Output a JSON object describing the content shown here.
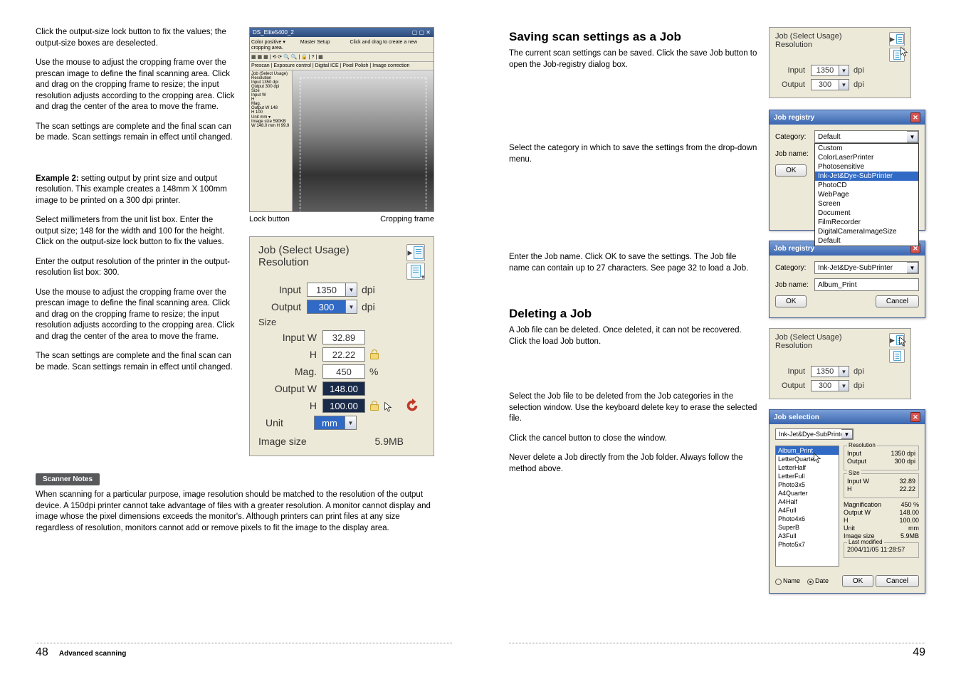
{
  "left": {
    "paragraphs": [
      "Click the output-size lock button to fix the values; the output-size boxes are deselected.",
      "Use the mouse to adjust the cropping frame over the prescan image to define the final scanning area. Click and drag on the cropping frame to resize; the input resolution adjusts according to the cropping area. Click and drag the center of the area to move the frame.",
      "The scan settings are complete and the final scan can be made. Scan settings remain in effect until changed."
    ],
    "example_strong": "Example 2:",
    "example_rest": " setting output by print size and output resolution. This example creates a 148mm X 100mm image to be printed on a 300 dpi printer.",
    "paragraphs2": [
      "Select millimeters from the unit list box. Enter the output size; 148 for the width and 100 for the height. Click on the output-size lock button to fix the values.",
      "Enter the output resolution of the printer in the output-resolution list box: 300.",
      "Use the mouse to adjust the cropping frame over the prescan image to define the final scanning area. Click and drag on the cropping frame to resize; the input resolution adjusts according to the cropping area. Click and drag the center of the area to move the frame.",
      "The scan settings are complete and the final scan can be made. Scan settings remain in effect until changed."
    ],
    "captions": {
      "lock": "Lock button",
      "crop": "Cropping frame"
    },
    "screenshot_title": "DS_Elite5400_2",
    "notes_label": "Scanner Notes",
    "notes_text": "When scanning for a particular purpose, image resolution should be matched to the resolution of the output device. A 150dpi printer cannot take advantage of files with a greater resolution. A monitor cannot display and image whose the pixel dimensions exceeds the monitor's. Although printers can print files at any size regardless of resolution, monitors cannot add or remove pixels to fit the image to the display area.",
    "panel": {
      "title": "Job (Select Usage)",
      "res": "Resolution",
      "input_lbl": "Input",
      "input_val": "1350",
      "dpi": "dpi",
      "output_lbl": "Output",
      "output_val": "300",
      "size_lbl": "Size",
      "inW_lbl": "Input   W",
      "inW_val": "32.89",
      "inH_lbl": "H",
      "inH_val": "22.22",
      "mag_lbl": "Mag.",
      "mag_val": "450",
      "pct": "%",
      "outW_lbl": "Output   W",
      "outW_val": "148.00",
      "outH_lbl": "H",
      "outH_val": "100.00",
      "unit_lbl": "Unit",
      "unit_val": "mm",
      "img_sz_lbl": "Image size",
      "img_sz_val": "5.9MB"
    },
    "page_num": "48",
    "section": "Advanced scanning"
  },
  "right": {
    "saving_title": "Saving scan settings as a Job",
    "saving_text": "The current scan settings can be saved. Click the save Job button to open the Job-registry dialog box.",
    "select_cat": "Select the category in which to save the settings from the drop-down menu.",
    "enter_job": "Enter the Job name. Click OK to save the settings. The Job file name can contain up to 27 characters. See page 32 to load a Job.",
    "delete_title": "Deleting a Job",
    "delete_text": "A Job file can be deleted. Once deleted, it can not be recovered. Click the load Job button.",
    "select_file": "Select the Job file to be deleted from the Job categories in the selection window. Use the keyboard delete key to erase the selected file.",
    "cancel_close": "Click the cancel button to close the window.",
    "never": "Never delete a Job directly from the Job folder. Always follow the method above.",
    "panel_small": {
      "title": "Job (Select Usage)",
      "res": "Resolution",
      "input_lbl": "Input",
      "input_val": "1350",
      "dpi": "dpi",
      "output_lbl": "Output",
      "output_val": "300"
    },
    "reg_dialog": {
      "title": "Job registry",
      "cat_lbl": "Category:",
      "cat_val": "Default",
      "name_lbl": "Job name:",
      "ok": "OK",
      "options": [
        "Custom",
        "ColorLaserPrinter",
        "Photosensitive",
        "Ink-Jet&Dye-SubPrinter",
        "PhotoCD",
        "WebPage",
        "Screen",
        "Document",
        "FilmRecorder",
        "DigitalCameraImageSize",
        "Default"
      ],
      "sel_idx": 3
    },
    "reg_dialog2": {
      "title": "Job registry",
      "cat_lbl": "Category:",
      "cat_val": "Ink-Jet&Dye-SubPrinter",
      "name_lbl": "Job name:",
      "name_val": "Album_Print",
      "ok": "OK",
      "cancel": "Cancel"
    },
    "jsel": {
      "title": "Job selection",
      "cat_val": "Ink-Jet&Dye-SubPrinter",
      "list": [
        "Album_Print",
        "LetterQuarter",
        "LetterHalf",
        "LetterFull",
        "Photo3x5",
        "A4Quarter",
        "A4Half",
        "A4Full",
        "Photo4x6",
        "SuperB",
        "A3Full",
        "Photo5x7"
      ],
      "sel_idx": 0,
      "res_grp": "Resolution",
      "input": "Input",
      "input_v": "1350",
      "dpi": "dpi",
      "output": "Output",
      "output_v": "300",
      "size_grp": "Size",
      "iw": "Input W",
      "iw_v": "32.89",
      "ih": "H",
      "ih_v": "22.22",
      "mag": "Magnification",
      "mag_v": "450",
      "pct": "%",
      "ow": "Output W",
      "ow_v": "148.00",
      "oh": "H",
      "oh_v": "100.00",
      "unit": "Unit",
      "unit_v": "mm",
      "isz": "Image size",
      "isz_v": "5.9MB",
      "lm_grp": "Last modified",
      "lm_v": "2004/11/05   11:28:57",
      "name_r": "Name",
      "date_r": "Date",
      "ok": "OK",
      "cancel": "Cancel"
    },
    "page_num": "49"
  }
}
